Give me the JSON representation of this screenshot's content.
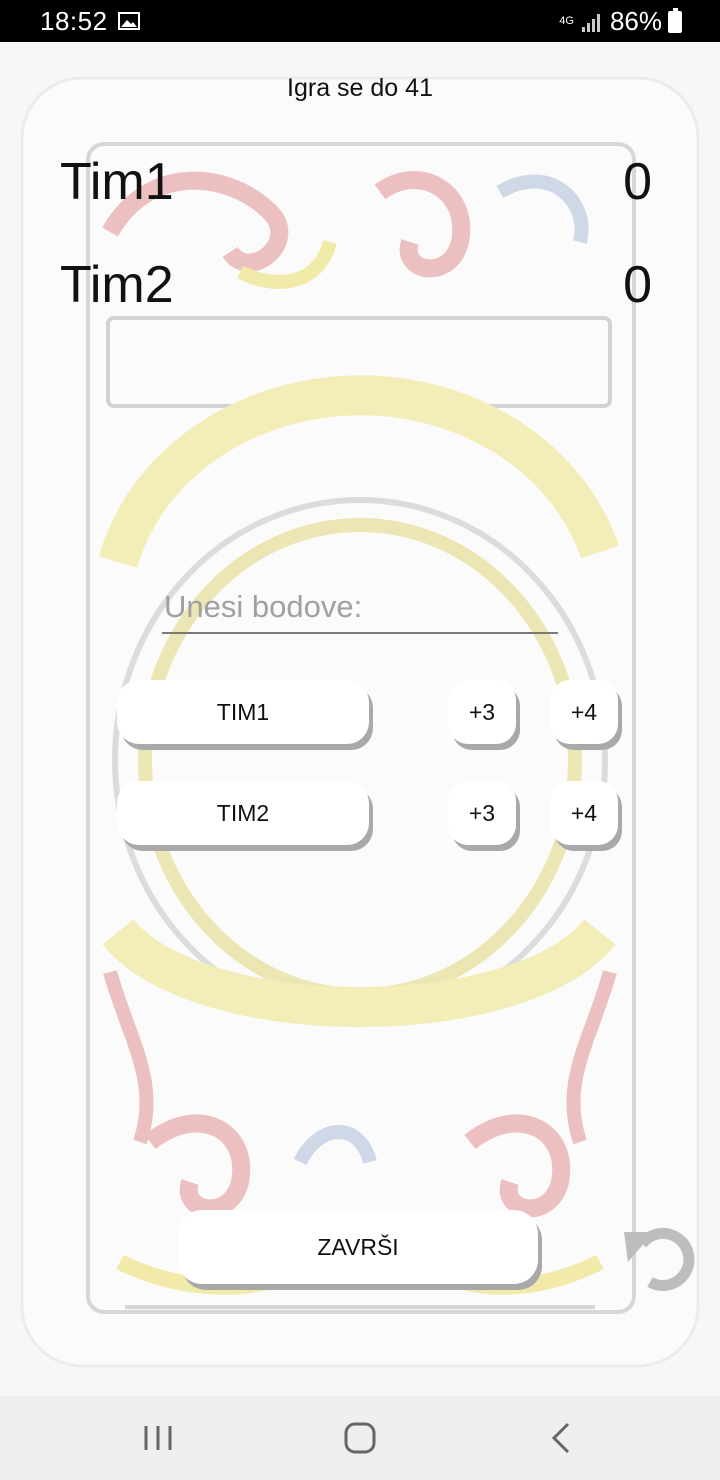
{
  "status_bar": {
    "time": "18:52",
    "battery": "86%",
    "network_label": "4G",
    "icons": [
      "image-icon",
      "signal-icon",
      "battery-icon"
    ]
  },
  "game": {
    "title": "Igra se do 41",
    "teams": [
      {
        "name": "Tim1",
        "score": "0"
      },
      {
        "name": "Tim2",
        "score": "0"
      }
    ]
  },
  "input": {
    "placeholder": "Unesi bodove:",
    "value": ""
  },
  "controls": {
    "team1_button": "TIM1",
    "team2_button": "TIM2",
    "plus3": "+3",
    "plus4": "+4",
    "finish_button": "ZAVRŠI"
  },
  "colors": {
    "accent_yellow": "#f2eaa8",
    "accent_red": "#e9a3a3",
    "accent_blue": "#b9c8dc"
  },
  "nav_bar": {
    "icons": [
      "recent-apps-icon",
      "home-icon",
      "back-icon"
    ]
  }
}
